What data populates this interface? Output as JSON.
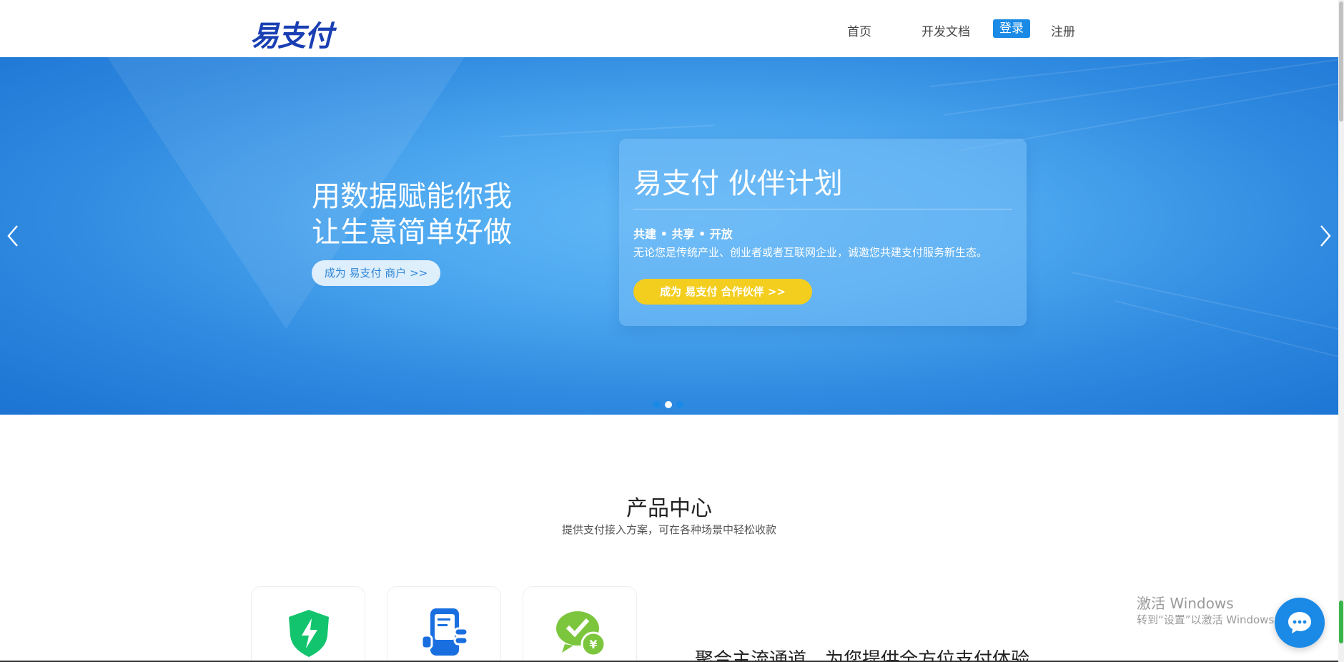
{
  "brand": {
    "logo_text": "易支付",
    "logo_color": "#1a3fb3"
  },
  "nav": {
    "home": "首页",
    "docs": "开发文档",
    "login": "登录",
    "register": "注册"
  },
  "banner": {
    "slogan_line1": "用数据赋能你我",
    "slogan_line2": "让生意简单好做",
    "merchant_button": "成为 易支付 商户 >>",
    "card_title": "易支付 伙伴计划",
    "card_tagline": "共建 • 共享 • 开放",
    "card_description": "无论您是传统产业、创业者或者互联网企业，诚邀您共建支付服务新生态。",
    "partner_button": "成为 易支付 合作伙伴 >>",
    "dots": 3,
    "active_dot": 2,
    "icons": [
      "chevron-left-icon",
      "chevron-right-icon"
    ]
  },
  "products": {
    "title": "产品中心",
    "subtitle": "提供支付接入方案，可在各种场景中轻松收款",
    "cards": [
      {
        "icon": "shield-lightning-icon"
      },
      {
        "icon": "mobile-payment-icon"
      },
      {
        "icon": "wechat-pay-icon"
      }
    ],
    "aggregate_title": "聚合主流通道，为您提供全方位支付体验"
  },
  "watermark": {
    "line1": "激活 Windows",
    "line2": "转到“设置”以激活 Windows。"
  },
  "colors": {
    "accent": "#1a8ae6",
    "partner_button": "#f3ce1f",
    "banner_blue": "#2f8ae0"
  }
}
